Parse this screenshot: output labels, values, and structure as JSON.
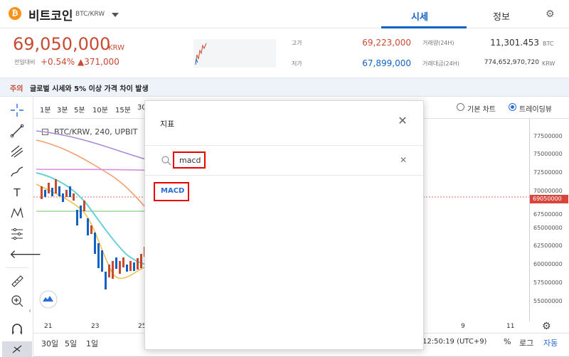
{
  "header": {
    "coin_symbol_glyph": "₿",
    "coin_name": "비트코인",
    "pair": "BTC/KRW",
    "tabs": [
      {
        "label": "시세",
        "active": true
      },
      {
        "label": "정보",
        "active": false
      }
    ]
  },
  "price": {
    "current": "69,050,000",
    "unit": "KRW",
    "prev_label": "전일대비",
    "change_pct": "+0.54%",
    "change_abs": "▲371,000"
  },
  "stats": {
    "high_label": "고가",
    "high": "69,223,000",
    "low_label": "저가",
    "low": "67,899,000",
    "volume_label": "거래량(24H)",
    "volume": "11,301.453",
    "volume_unit": "BTC",
    "amount_label": "거래대금(24H)",
    "amount": "774,652,970,720",
    "amount_unit": "KRW"
  },
  "notice": {
    "tag": "주의",
    "text": "글로벌 시세와 5% 이상 가격 차이 발생"
  },
  "timeframes": [
    "1분",
    "3분",
    "5분",
    "10분",
    "15분",
    "30"
  ],
  "chart_mode": {
    "basic_label": "기본 차트",
    "trading_label": "트레이딩뷰",
    "selected": "트레이딩뷰"
  },
  "legend": "BTC/KRW, 240, UPBIT",
  "y_ticks": [
    "77500000",
    "75000000",
    "72500000",
    "70000000",
    "67500000",
    "65000000",
    "62500000",
    "60000000",
    "57500000",
    "55000000"
  ],
  "current_price_tag": "69050000",
  "x_ticks": [
    "21",
    "23",
    "25",
    "9",
    "11"
  ],
  "ranges": [
    "30일",
    "5일",
    "1일"
  ],
  "time_text": "12:50:19 (UTC+9)",
  "bottom_controls": {
    "percent": "%",
    "log": "로그",
    "auto": "자동"
  },
  "indicator_dialog": {
    "title": "지표",
    "search_value": "macd",
    "results": [
      "MACD"
    ]
  },
  "colors": {
    "up": "#c84a31",
    "down": "#1261c4",
    "accent": "#2a6cd4",
    "highlight_box": "#e60000"
  },
  "icons": {
    "crosshair": "crosshair-icon",
    "trendline": "trendline-icon",
    "pitchfork": "pitchfork-icon",
    "brush": "brush-icon",
    "text": "text-icon",
    "pattern": "pattern-icon",
    "measure": "measure-icon",
    "back": "arrow-left-icon",
    "ruler": "ruler-icon",
    "zoom": "zoom-in-icon",
    "magnet": "magnet-icon",
    "settings": "gear-icon"
  }
}
